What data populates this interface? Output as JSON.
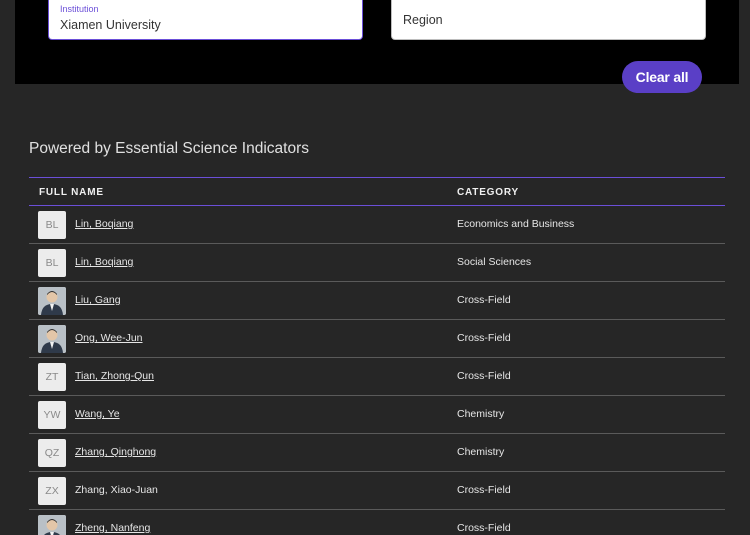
{
  "filters": {
    "institution_label": "Institution",
    "institution_value": "Xiamen University",
    "region_placeholder": "Region"
  },
  "clear_all_label": "Clear all",
  "powered_by": "Powered by Essential Science Indicators",
  "table": {
    "headers": {
      "name": "FULL NAME",
      "category": "CATEGORY"
    },
    "rows": [
      {
        "initials": "BL",
        "name": "Lin, Boqiang",
        "category": "Economics and Business",
        "photo": false,
        "link": true
      },
      {
        "initials": "BL",
        "name": "Lin, Boqiang",
        "category": "Social Sciences",
        "photo": false,
        "link": true
      },
      {
        "initials": "",
        "name": "Liu, Gang",
        "category": "Cross-Field",
        "photo": true,
        "link": true
      },
      {
        "initials": "",
        "name": "Ong, Wee-Jun",
        "category": "Cross-Field",
        "photo": true,
        "link": true
      },
      {
        "initials": "ZT",
        "name": "Tian, Zhong-Qun",
        "category": "Cross-Field",
        "photo": false,
        "link": true
      },
      {
        "initials": "YW",
        "name": "Wang, Ye",
        "category": "Chemistry",
        "photo": false,
        "link": true
      },
      {
        "initials": "QZ",
        "name": "Zhang, Qinghong",
        "category": "Chemistry",
        "photo": false,
        "link": true
      },
      {
        "initials": "ZX",
        "name": "Zhang, Xiao-Juan",
        "category": "Cross-Field",
        "photo": false,
        "link": false
      },
      {
        "initials": "",
        "name": "Zheng, Nanfeng",
        "category": "Cross-Field",
        "photo": true,
        "link": true
      }
    ]
  },
  "colors": {
    "accent": "#5a3fc6",
    "page_bg": "#262626",
    "panel_bg": "#000000"
  }
}
